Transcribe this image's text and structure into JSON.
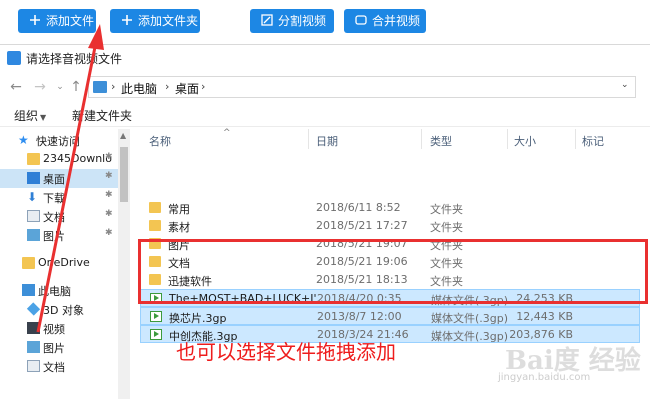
{
  "toolbar": {
    "add_file": "添加文件",
    "add_folder": "添加文件夹",
    "split_video": "分割视频",
    "merge_video": "合并视频"
  },
  "dialog": {
    "title": "请选择音视频文件",
    "breadcrumb": [
      "此电脑",
      "桌面"
    ],
    "organize": "组织",
    "new_folder": "新建文件夹"
  },
  "nav": {
    "items": [
      {
        "label": "快速访问",
        "icon": "star-icon"
      },
      {
        "label": "2345Downlo",
        "icon": "folder-icon"
      },
      {
        "label": "桌面",
        "icon": "desktop-icon"
      },
      {
        "label": "下载",
        "icon": "download-icon"
      },
      {
        "label": "文档",
        "icon": "document-icon"
      },
      {
        "label": "图片",
        "icon": "picture-icon"
      },
      {
        "label": "OneDrive",
        "icon": "folder-icon"
      },
      {
        "label": "此电脑",
        "icon": "computer-icon"
      },
      {
        "label": "3D 对象",
        "icon": "3d-object-icon"
      },
      {
        "label": "视频",
        "icon": "video-icon"
      },
      {
        "label": "图片",
        "icon": "picture-icon"
      },
      {
        "label": "文档",
        "icon": "document-icon"
      }
    ]
  },
  "columns": {
    "name": "名称",
    "date": "日期",
    "type": "类型",
    "size": "大小",
    "tags": "标记"
  },
  "files": [
    {
      "name": "常用",
      "date": "2018/6/11 8:52",
      "type": "文件夹",
      "size": "",
      "kind": "folder"
    },
    {
      "name": "素材",
      "date": "2018/5/21 17:27",
      "type": "文件夹",
      "size": "",
      "kind": "folder"
    },
    {
      "name": "图片",
      "date": "2018/5/21 19:07",
      "type": "文件夹",
      "size": "",
      "kind": "folder"
    },
    {
      "name": "文档",
      "date": "2018/5/21 19:06",
      "type": "文件夹",
      "size": "",
      "kind": "folder"
    },
    {
      "name": "迅捷软件",
      "date": "2018/5/21 18:13",
      "type": "文件夹",
      "size": "",
      "kind": "folder"
    },
    {
      "name": "The+MOST+BAD+LUCK+I'...",
      "date": "2018/4/20 0:35",
      "type": "媒体文件(.3gp)",
      "size": "24,253 KB",
      "kind": "media"
    },
    {
      "name": "换芯片.3gp",
      "date": "2013/8/7 12:00",
      "type": "媒体文件(.3gp)",
      "size": "12,443 KB",
      "kind": "media"
    },
    {
      "name": "中创杰能.3gp",
      "date": "2018/3/24 21:46",
      "type": "媒体文件(.3gp)",
      "size": "203,876 KB",
      "kind": "media"
    }
  ],
  "annotation": {
    "hint": "也可以选择文件拖拽添加",
    "color": "#ee1c1c"
  },
  "watermark": {
    "logo": "Bai度 经验",
    "url": "jingyan.baidu.com"
  },
  "colors": {
    "accent": "#1d87e4",
    "selection": "#cce8ff"
  }
}
